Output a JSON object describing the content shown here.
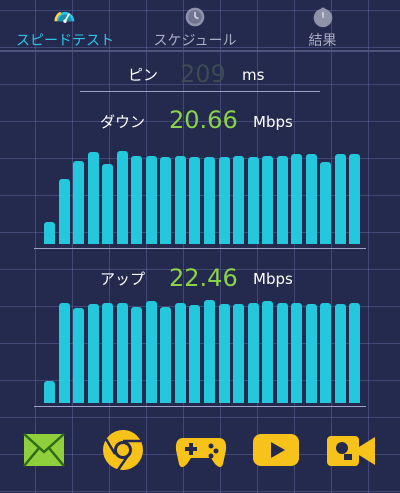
{
  "tabs": [
    {
      "label": "スピードテスト",
      "icon": "speedometer-icon",
      "active": true
    },
    {
      "label": "スケジュール",
      "icon": "clock-icon",
      "active": false
    },
    {
      "label": "結果",
      "icon": "result-icon",
      "active": false
    }
  ],
  "ping": {
    "label": "ピン",
    "value": "209",
    "unit": "ms"
  },
  "download": {
    "label": "ダウン",
    "value": "20.66",
    "unit": "Mbps"
  },
  "upload": {
    "label": "アップ",
    "value": "22.46",
    "unit": "Mbps"
  },
  "chart_data": [
    {
      "type": "bar",
      "title": "",
      "series": [
        {
          "values": [
            0.2,
            0.58,
            0.74,
            0.82,
            0.71,
            0.83,
            0.79,
            0.79,
            0.78,
            0.79,
            0.78,
            0.78,
            0.78,
            0.79,
            0.78,
            0.79,
            0.79,
            0.8,
            0.8,
            0.73,
            0.8,
            0.8
          ]
        }
      ]
    },
    {
      "type": "bar",
      "title": "",
      "series": [
        {
          "values": [
            0.2,
            0.93,
            0.88,
            0.92,
            0.93,
            0.93,
            0.89,
            0.94,
            0.89,
            0.93,
            0.91,
            0.95,
            0.92,
            0.92,
            0.93,
            0.94,
            0.93,
            0.93,
            0.92,
            0.93,
            0.92,
            0.93
          ]
        }
      ]
    }
  ],
  "colors": {
    "background": "#232a4e",
    "accent": "#2ec3e6",
    "value": "#8bd14a",
    "bar": "#23c8dc"
  },
  "apps": [
    {
      "name": "mail-icon"
    },
    {
      "name": "chrome-icon"
    },
    {
      "name": "game-controller-icon"
    },
    {
      "name": "youtube-icon"
    },
    {
      "name": "video-camera-icon"
    }
  ]
}
